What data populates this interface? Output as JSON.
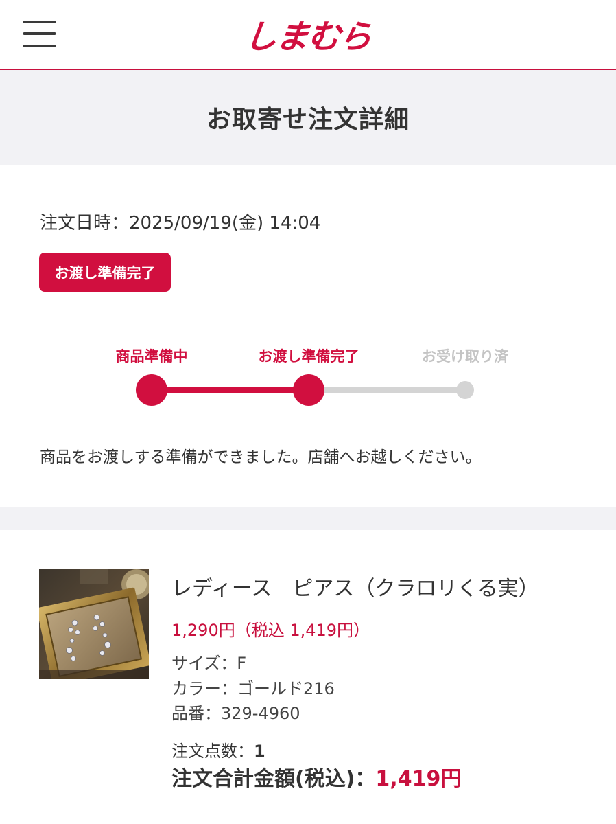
{
  "header": {
    "logo_text": "しまむら",
    "brand_color": "#d10f3f"
  },
  "page": {
    "title": "お取寄せ注文詳細"
  },
  "order": {
    "date_label": "注文日時：2025/09/19(金) 14:04",
    "status_badge": "お渡し準備完了",
    "steps": [
      {
        "label": "商品準備中",
        "state": "done"
      },
      {
        "label": "お渡し準備完了",
        "state": "current"
      },
      {
        "label": "お受け取り済",
        "state": "pending"
      }
    ],
    "status_message": "商品をお渡しする準備ができました。店舗へお越しください。"
  },
  "product": {
    "name": "レディース　ピアス（クラロリくる実）",
    "price": "1,290円（税込 1,419円）",
    "size": "サイズ：F",
    "color": "カラー：ゴールド216",
    "item_number": "品番：329-4960",
    "quantity_label": "注文点数：",
    "quantity_value": "1",
    "total_label": "注文合計金額(税込)：",
    "total_value": "1,419円"
  }
}
